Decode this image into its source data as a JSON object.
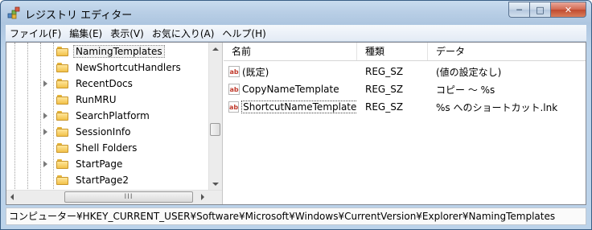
{
  "window": {
    "title": "レジストリ エディター"
  },
  "caption_buttons": {
    "minimize": "─",
    "maximize": "□",
    "close": "✕"
  },
  "menu": [
    "ファイル(F)",
    "編集(E)",
    "表示(V)",
    "お気に入り(A)",
    "ヘルプ(H)"
  ],
  "tree": {
    "items": [
      {
        "label": "NamingTemplates",
        "expandable": false,
        "selected": true
      },
      {
        "label": "NewShortcutHandlers",
        "expandable": false
      },
      {
        "label": "RecentDocs",
        "expandable": true
      },
      {
        "label": "RunMRU",
        "expandable": false
      },
      {
        "label": "SearchPlatform",
        "expandable": true
      },
      {
        "label": "SessionInfo",
        "expandable": true
      },
      {
        "label": "Shell Folders",
        "expandable": false
      },
      {
        "label": "StartPage",
        "expandable": true
      },
      {
        "label": "StartPage2",
        "expandable": false
      }
    ],
    "hscroll_thumb_text": "III"
  },
  "list": {
    "columns": [
      "名前",
      "種類",
      "データ"
    ],
    "rows": [
      {
        "icon": "string-value-icon",
        "name": "(既定)",
        "type": "REG_SZ",
        "data": "(値の設定なし)"
      },
      {
        "icon": "string-value-icon",
        "name": "CopyNameTemplate",
        "type": "REG_SZ",
        "data": "コピー ～ %s"
      },
      {
        "icon": "string-value-icon",
        "name": "ShortcutNameTemplate",
        "type": "REG_SZ",
        "data": "%s へのショートカット.lnk",
        "focused": true
      }
    ]
  },
  "status": {
    "path": "コンピューター¥HKEY_CURRENT_USER¥Software¥Microsoft¥Windows¥CurrentVersion¥Explorer¥NamingTemplates"
  },
  "colors": {
    "title_gradient": "#bcd3ea",
    "close_button": "#c04a2f",
    "icon_ab": "#c0392b",
    "folder": "#f2c24a"
  }
}
